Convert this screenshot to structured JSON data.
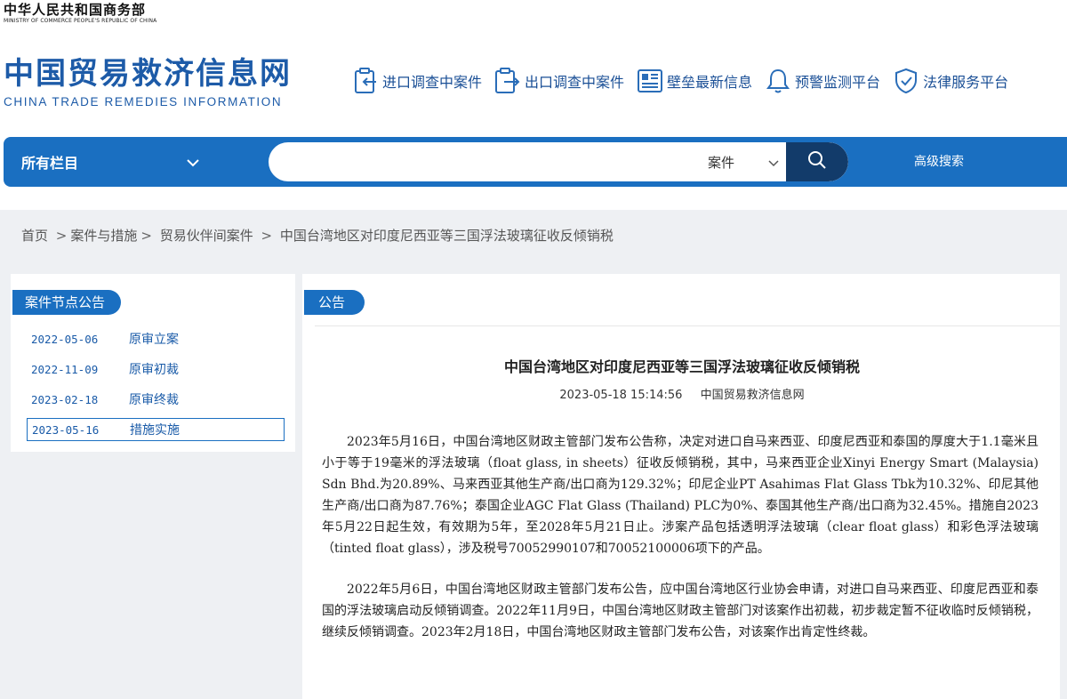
{
  "header": {
    "ministry_cn": "中华人民共和国商务部",
    "ministry_en": "MINISTRY OF COMMERCE PEOPLE'S REPUBLIC OF CHINA",
    "site_title_cn": "中国贸易救济信息网",
    "site_title_en": "CHINA TRADE REMEDIES INFORMATION"
  },
  "topnav": [
    {
      "label": "进口调查中案件",
      "icon": "import-case-icon"
    },
    {
      "label": "出口调查中案件",
      "icon": "export-case-icon"
    },
    {
      "label": "壁垒最新信息",
      "icon": "barrier-news-icon"
    },
    {
      "label": "预警监测平台",
      "icon": "bell-icon"
    },
    {
      "label": "法律服务平台",
      "icon": "shield-check-icon"
    }
  ],
  "search": {
    "column_select": "所有栏目",
    "placeholder": "",
    "type_select": "案件",
    "advanced_label": "高级搜索"
  },
  "breadcrumb": {
    "home": "首页",
    "level1": "案件与措施",
    "level2": "贸易伙伴间案件",
    "current": "中国台湾地区对印度尼西亚等三国浮法玻璃征收反倾销税"
  },
  "nodes": {
    "heading": "案件节点公告",
    "items": [
      {
        "date": "2022-05-06",
        "stage": "原审立案"
      },
      {
        "date": "2022-11-09",
        "stage": "原审初裁"
      },
      {
        "date": "2023-02-18",
        "stage": "原审终裁"
      },
      {
        "date": "2023-05-16",
        "stage": "措施实施",
        "active": true
      }
    ]
  },
  "article": {
    "tab": "公告",
    "title": "中国台湾地区对印度尼西亚等三国浮法玻璃征收反倾销税",
    "datetime": "2023-05-18 15:14:56",
    "source": "中国贸易救济信息网",
    "paragraphs": [
      "2023年5月16日，中国台湾地区财政主管部门发布公告称，决定对进口自马来西亚、印度尼西亚和泰国的厚度大于1.1毫米且小于等于19毫米的浮法玻璃（float glass, in sheets）征收反倾销税，其中，马来西亚企业Xinyi Energy Smart (Malaysia) Sdn Bhd.为20.89%、马来西亚其他生产商/出口商为129.32%；印尼企业PT Asahimas Flat Glass Tbk为10.32%、印尼其他生产商/出口商为87.76%；泰国企业AGC Flat Glass (Thailand) PLC为0%、泰国其他生产商/出口商为32.45%。措施自2023年5月22日起生效，有效期为5年，至2028年5月21日止。涉案产品包括透明浮法玻璃（clear float glass）和彩色浮法玻璃（tinted float glass），涉及税号70052990107和70052100006项下的产品。",
      "2022年5月6日，中国台湾地区财政主管部门发布公告，应中国台湾地区行业协会申请，对进口自马来西亚、印度尼西亚和泰国的浮法玻璃启动反倾销调查。2022年11月9日，中国台湾地区财政主管部门对该案作出初裁，初步裁定暂不征收临时反倾销税，继续反倾销调查。2023年2月18日，中国台湾地区财政主管部门发布公告，对该案作出肯定性终裁。"
    ]
  },
  "colors": {
    "brand_blue": "#1a6fc1",
    "logo_blue": "#1d5ba8",
    "search_button": "#123b6a",
    "band_gray": "#eef0f3"
  }
}
